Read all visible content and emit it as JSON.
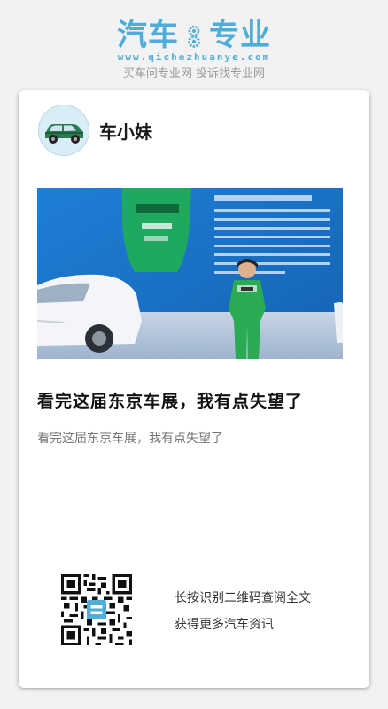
{
  "header": {
    "logo_left": "汽车",
    "logo_right": "专业",
    "domain": "www.qichezhuanye.com",
    "slogan": "买车问专业网 投诉找专业网"
  },
  "card": {
    "author_name": "车小妹",
    "avatar_icon": "green-car-icon",
    "cover_image": "tokyo-motor-show-photo",
    "title": "看完这届东京车展，我有点失望了",
    "summary": "看完这届东京车展，我有点失望了",
    "qr_line1": "长按识别二维码查阅全文",
    "qr_line2": "获得更多汽车资讯"
  },
  "colors": {
    "brand": "#4faed8",
    "background": "#f2f2f2",
    "card": "#ffffff"
  }
}
